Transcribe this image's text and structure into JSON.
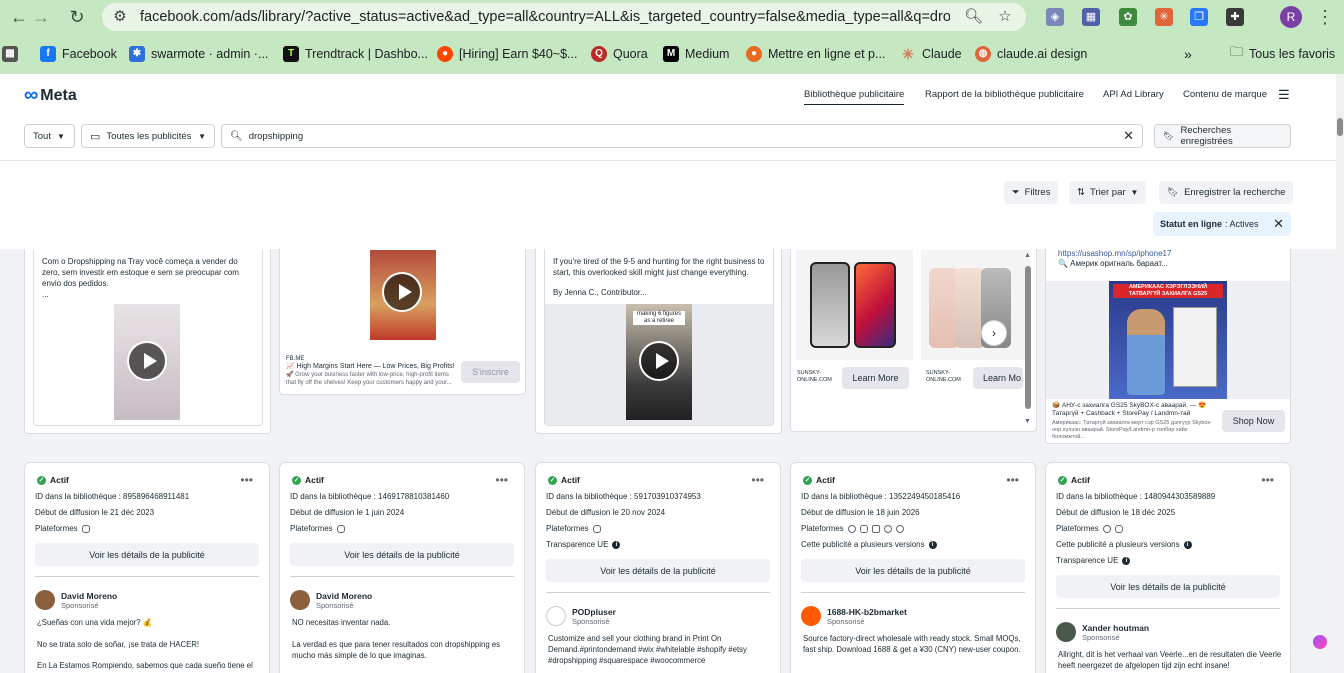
{
  "browser": {
    "url": "facebook.com/ads/library/?active_status=active&ad_type=all&country=ALL&is_targeted_country=false&media_type=all&q=drop...",
    "profile_initial": "R",
    "bookmarks": [
      "Facebook",
      "swarmote · admin ·...",
      "Trendtrack | Dashbo...",
      "[Hiring] Earn $40~$...",
      "Quora",
      "Medium",
      "Mettre en ligne et p...",
      "Claude",
      "claude.ai design"
    ],
    "all_bookmarks": "Tous les favoris"
  },
  "meta": {
    "logo": "Meta",
    "tabs": [
      "Bibliothèque publicitaire",
      "Rapport de la bibliothèque publicitaire",
      "API Ad Library",
      "Contenu de marque"
    ]
  },
  "search": {
    "country": "Tout",
    "ad_type": "Toutes les publicités",
    "query": "dropshipping",
    "saved_searches": "Recherches enregistrées"
  },
  "filters": {
    "filters_label": "Filtres",
    "sort_label": "Trier par",
    "save_search": "Enregistrer la recherche",
    "status_label": "Statut en ligne",
    "status_value": ": Actives"
  },
  "top_cards": {
    "c1_text": "Com o Dropshipping na Tray você começa a vender do zero, sem investir em estoque e sem se preocupar com envio dos pedidos.",
    "c1_more": "...",
    "c2_domain": "FB.ME",
    "c2_title": "📈 High Margins Start Here — Low Prices, Big Profits!",
    "c2_desc": "🚀 Grow your business faster with low-price, high-profit items that fly off the shelves! Keep your customers happy and your...",
    "c2_cta": "S'inscrire",
    "c3_text1": "If you're tired of the 9-5 and hunting for the right business to start, this overlooked skill might just change everything.",
    "c3_text2": "By Jenna C., Contributor...",
    "c3_overlay": "making 6 figures as a retiree",
    "c4_domain1": "SUNSKY-ONLINE.COM",
    "c4_cta1": "Learn More",
    "c4_domain2": "SUNSKY-ONLINE.COM",
    "c4_cta2": "Learn Mo",
    "c5_link": "https://usashop.mn/sp/iphone17",
    "c5_line": "🔍 Америк оригналь бараат...",
    "c5_title": "📦 АНУ-с захиалга GS25 SkyBOX-с аваарай. — 😍 Татаргүй + Cashback + StorePay / Landmn-тай",
    "c5_desc": "Америкаас: Татаргүй захиалга мерт сэр GS25 дэлгүүр Skybox-оор хүлээн аваарай. StorePay/Landmn-р төлбөр хийх боломжтой...",
    "c5_cta": "Shop Now",
    "c5_banner": "АМЕРИКААС ХЭРЭГЛЭЭНИЙ ТАТВАРГҮЙ ЗАХИАЛГА GS25"
  },
  "cards": [
    {
      "status": "Actif",
      "id": "ID dans la bibliothèque : 895896468911481",
      "start": "Début de diffusion le 21 déc 2023",
      "platforms": "Plateformes",
      "details": "Voir les détails de la publicité",
      "advertiser": "David Moreno",
      "sponsored": "Sponsorisé",
      "body1": "¿Sueñas con una vida mejor? 💰",
      "body2": "No se trata solo de soñar, ¡se trata de HACER!",
      "body3": "En La Estamos Rompiendo, sabemos que cada sueño tiene el"
    },
    {
      "status": "Actif",
      "id": "ID dans la bibliothèque : 1469178810381460",
      "start": "Début de diffusion le 1 juin 2024",
      "platforms": "Plateformes",
      "details": "Voir les détails de la publicité",
      "advertiser": "David Moreno",
      "sponsored": "Sponsorisé",
      "body1": "NO necesitas inventar nada.",
      "body2": "La verdad es que para tener resultados con dropshipping es mucho más simple de lo que imaginas."
    },
    {
      "status": "Actif",
      "id": "ID dans la bibliothèque : 591703910374953",
      "start": "Début de diffusion le 20 nov 2024",
      "platforms": "Plateformes",
      "transparency": "Transparence UE",
      "details": "Voir les détails de la publicité",
      "advertiser": "PODpluser",
      "sponsored": "Sponsorisé",
      "body1": "Customize and sell your clothing brand in Print On Demand.#printondemand #wix #whitelable #shopify #etsy #dropshipping #squarespace #woocommerce"
    },
    {
      "status": "Actif",
      "id": "ID dans la bibliothèque : 1352249450185416",
      "start": "Début de diffusion le 18 juin 2026",
      "platforms": "Plateformes",
      "versions": "Cette publicité a plusieurs versions",
      "details": "Voir les détails de la publicité",
      "advertiser": "1688-HK-b2bmarket",
      "sponsored": "Sponsorisé",
      "body1": "Source factory-direct wholesale with ready stock. Small MOQs, fast ship. Download 1688 & get a ¥30 (CNY) new-user coupon."
    },
    {
      "status": "Actif",
      "id": "ID dans la bibliothèque : 1480944303589889",
      "start": "Début de diffusion le 18 déc 2025",
      "platforms": "Plateformes",
      "versions": "Cette publicité a plusieurs versions",
      "transparency": "Transparence UE",
      "details": "Voir les détails de la publicité",
      "advertiser": "Xander houtman",
      "sponsored": "Sponsorisé",
      "body1": "Allright, dit is het verhaal van Veerle...en de resultaten die Veerle heeft neergezet de afgelopen tijd zijn echt insane!"
    }
  ]
}
